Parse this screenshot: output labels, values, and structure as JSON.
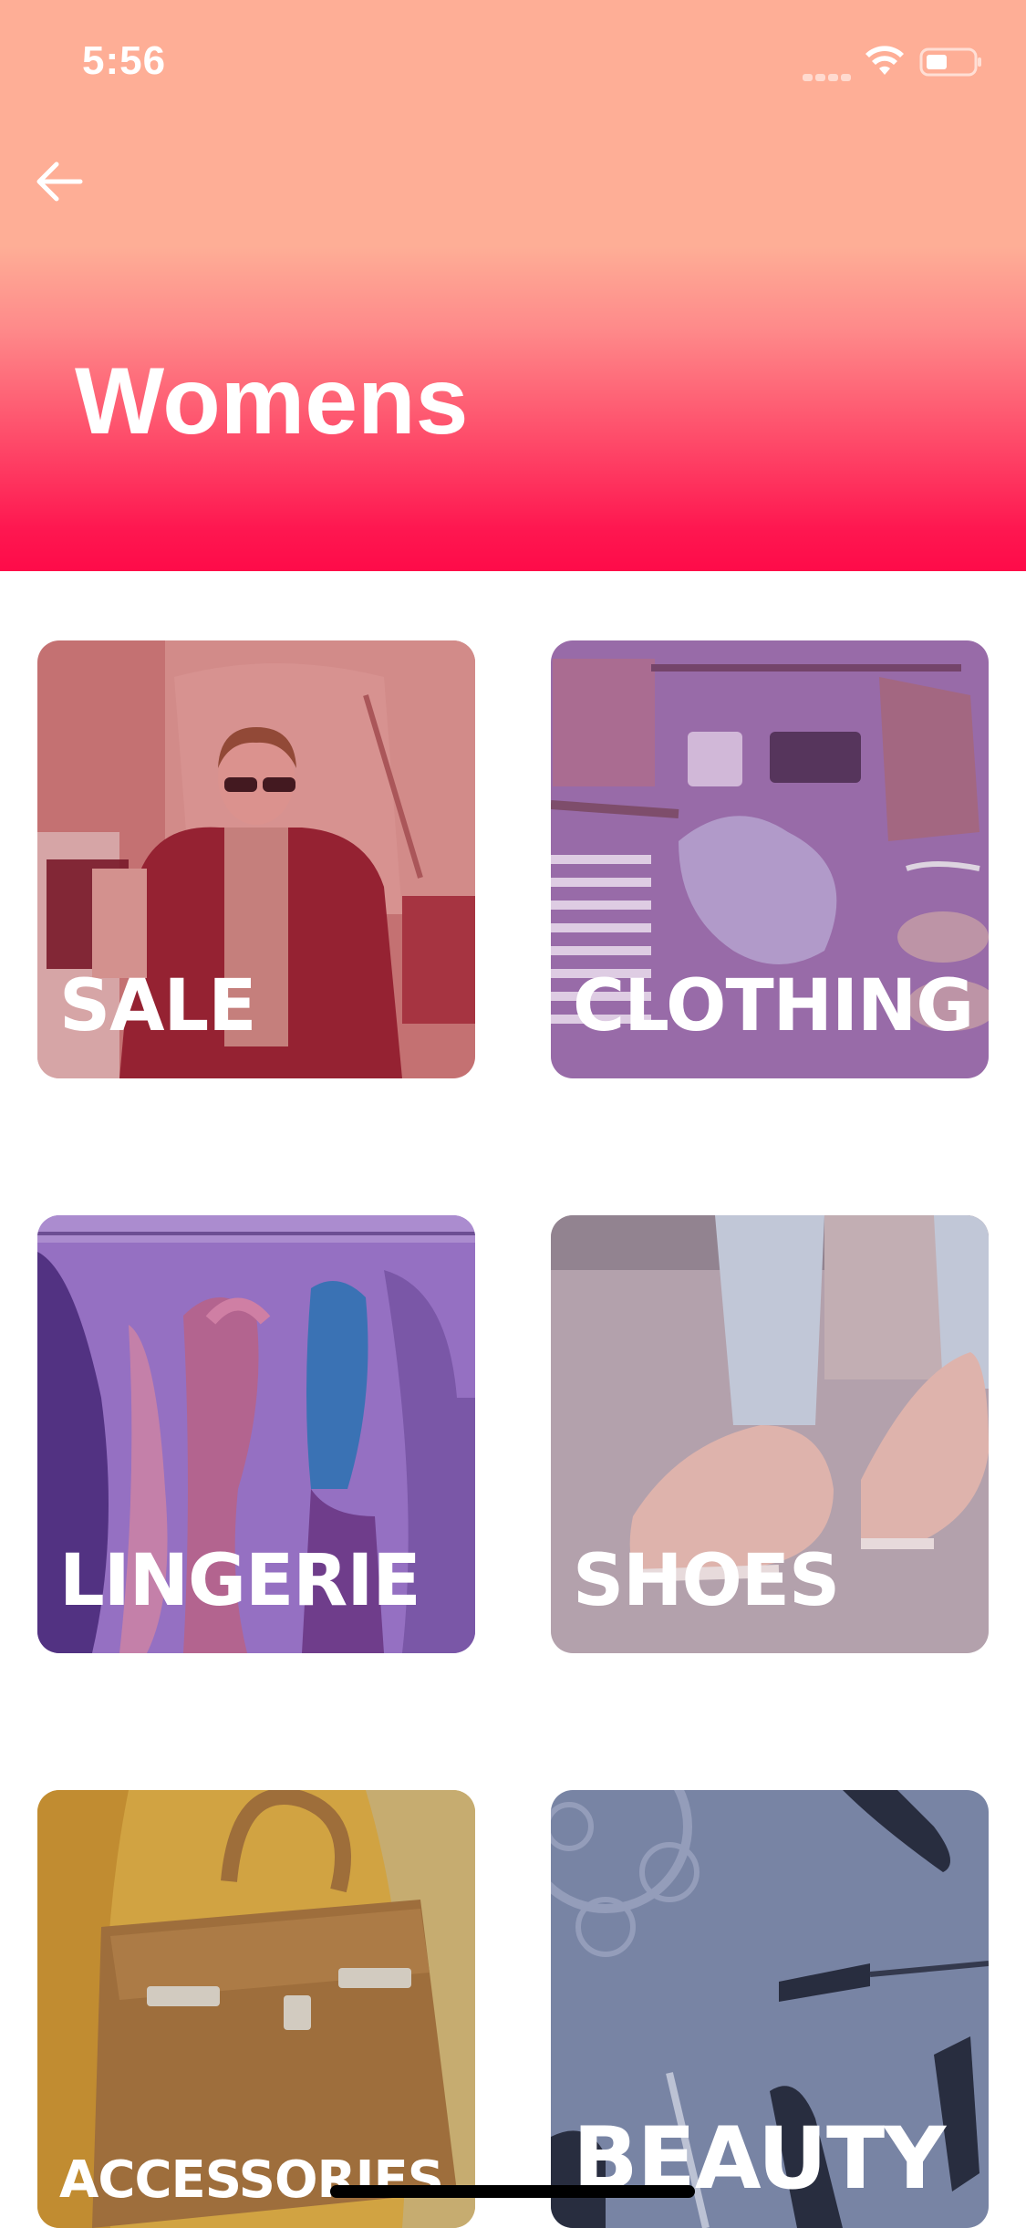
{
  "status_bar": {
    "time": "5:56"
  },
  "header": {
    "title": "Womens",
    "back_icon": "arrow-left-icon"
  },
  "colors": {
    "header_top": "#feae96",
    "header_bottom": "#fe0b49",
    "sale_overlay": "#b8495a",
    "clothing_overlay": "#8e5c9e",
    "lingerie_overlay": "#7a4ca8",
    "shoes_overlay": "#a89aa8",
    "accessories_overlay": "#b8893a",
    "beauty_overlay": "#6f7a9c"
  },
  "categories": [
    {
      "label": "SALE"
    },
    {
      "label": "CLOTHING"
    },
    {
      "label": "LINGERIE"
    },
    {
      "label": "SHOES"
    },
    {
      "label": "ACCESSORIES"
    },
    {
      "label": "BEAUTY"
    }
  ]
}
